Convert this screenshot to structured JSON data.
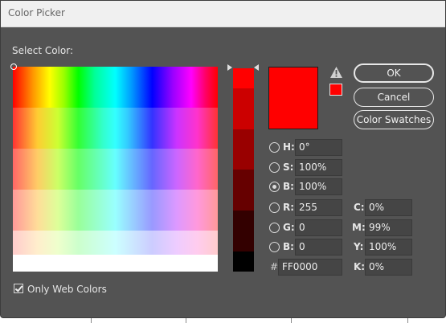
{
  "window": {
    "title": "Color Picker"
  },
  "select_color_label": "Select Color:",
  "current_color": "#FF0000",
  "buttons": {
    "ok": "OK",
    "cancel": "Cancel",
    "color_swatches": "Color Swatches"
  },
  "icons": {
    "warning": "warning-triangle-icon",
    "checkmark": "checkmark-icon"
  },
  "fields": {
    "h": {
      "label": "H:",
      "value": "0°"
    },
    "s": {
      "label": "S:",
      "value": "100%"
    },
    "b_hsb": {
      "label": "B:",
      "value": "100%"
    },
    "r": {
      "label": "R:",
      "value": "255"
    },
    "g": {
      "label": "G:",
      "value": "0"
    },
    "b_rgb": {
      "label": "B:",
      "value": "0"
    },
    "hex": {
      "label": "#",
      "value": "FF0000"
    },
    "c": {
      "label": "C:",
      "value": "0%"
    },
    "m": {
      "label": "M:",
      "value": "99%"
    },
    "y": {
      "label": "Y:",
      "value": "100%"
    },
    "k": {
      "label": "K:",
      "value": "0%"
    }
  },
  "selected_mode": "B",
  "only_web_colors": {
    "label": "Only Web Colors",
    "checked": true
  }
}
